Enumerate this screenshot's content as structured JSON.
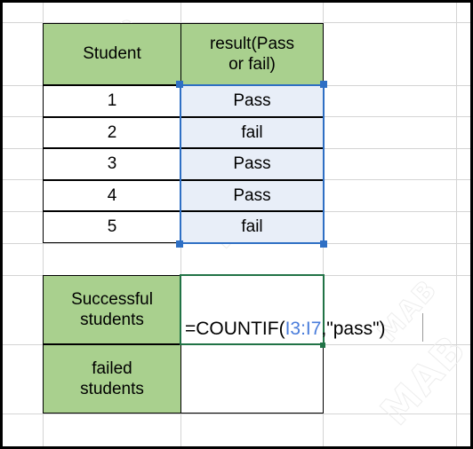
{
  "app": {
    "type": "spreadsheet",
    "watermark_text": "MAB"
  },
  "colors": {
    "header_fill": "#a9d08e",
    "selected_fill": "#e8eef8",
    "selection_border": "#2e6fc4",
    "active_cell_border": "#217346",
    "gridline": "#d4d4d4",
    "formula_reference": "#4a7ddb",
    "text": "#000000"
  },
  "table": {
    "headers": {
      "student": "Student",
      "result": "result(Pass or fail)",
      "result_line1": "result(Pass",
      "result_line2": "or fail)"
    },
    "rows": [
      {
        "student": "1",
        "result": "Pass"
      },
      {
        "student": "2",
        "result": "fail"
      },
      {
        "student": "3",
        "result": "Pass"
      },
      {
        "student": "4",
        "result": "Pass"
      },
      {
        "student": "5",
        "result": "fail"
      }
    ]
  },
  "summary": {
    "successful": {
      "label": "Successful students",
      "label_line1": "Successful",
      "label_line2": "students",
      "value": ""
    },
    "failed": {
      "label": "failed students",
      "label_line1": "failed",
      "label_line2": "students",
      "value": ""
    }
  },
  "formula": {
    "full_text": "=COUNTIF(I3:I7,\"pass\")",
    "prefix": "=COUNTIF(",
    "reference": "I3:I7",
    "suffix": ",\"pass\")"
  }
}
